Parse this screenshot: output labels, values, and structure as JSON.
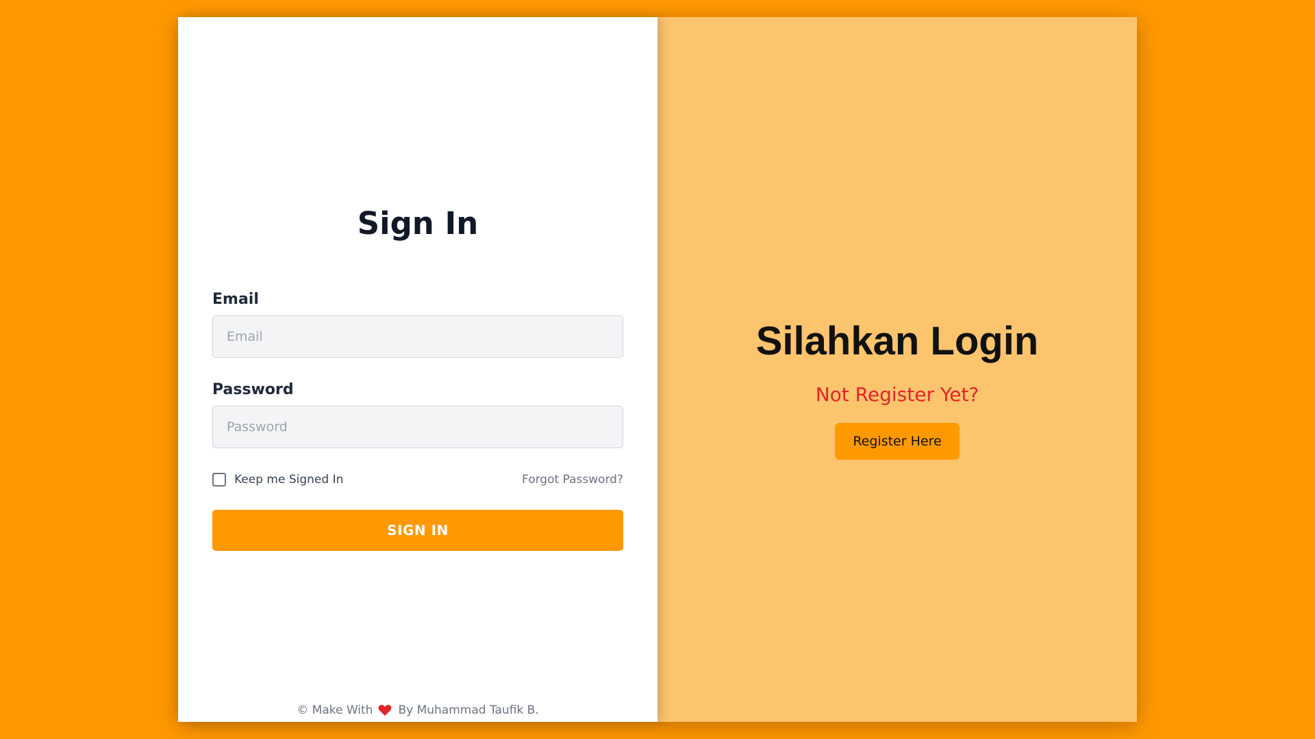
{
  "signin": {
    "title": "Sign In",
    "email_label": "Email",
    "email_placeholder": "Email",
    "password_label": "Password",
    "password_placeholder": "Password",
    "remember_label": "Keep me Signed In",
    "forgot_label": "Forgot Password?",
    "submit_label": "SIGN IN"
  },
  "footer": {
    "prefix": "© Make With",
    "suffix": "By Muhammad Taufik B.",
    "icon": "heart-icon"
  },
  "register": {
    "title": "Silahkan Login",
    "subtitle": "Not Register Yet?",
    "button_label": "Register Here"
  },
  "colors": {
    "background": "#ff9900",
    "panel_right": "#fdc46e",
    "accent": "#ff9900",
    "subtitle_red": "#e0262a",
    "heart": "#e0262a"
  }
}
